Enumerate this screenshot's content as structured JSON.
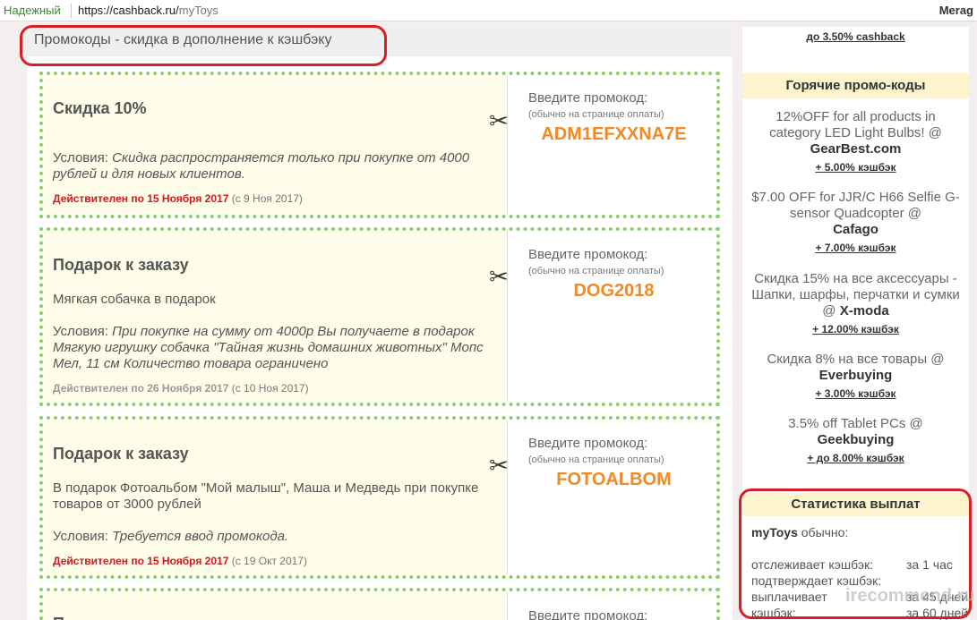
{
  "browser": {
    "secure_label": "Надежный",
    "url_host": "https://cashback.ru/",
    "url_path": "myToys",
    "user": "Merag"
  },
  "main": {
    "title": "Промокоды - скидка в дополнение к кэшбэку",
    "promos": [
      {
        "title": "Скидка 10%",
        "desc": "",
        "cond_label": "Условия:",
        "cond_text": "Скидка распространяется только при покупке от 4000 рублей и для новых клиентов.",
        "valid": "Действителен по 15 Ноября 2017",
        "since": "(с 9 Ноя 2017)",
        "enter_label": "Введите промокод:",
        "enter_hint": "(обычно на странице оплаты)",
        "code": "ADM1EFXXNA7E"
      },
      {
        "title": "Подарок к заказу",
        "desc": "Мягкая собачка в подарок",
        "cond_label": "Условия:",
        "cond_text": "При покупке на сумму от 4000р Вы получаете в подарок Мягкую игрушку собачка \"Тайная жизнь домашних животных\" Мопс Мел, 11 см Количество товара ограничено",
        "valid": "Действителен по 26 Ноября 2017",
        "since": "(с 10 Ноя 2017)",
        "enter_label": "Введите промокод:",
        "enter_hint": "(обычно на странице оплаты)",
        "code": "DOG2018"
      },
      {
        "title": "Подарок к заказу",
        "desc": "В подарок Фотоальбом \"Мой малыш\", Маша и Медведь при покупке товаров от 3000 рублей",
        "cond_label": "Условия:",
        "cond_text": "Требуется ввод промокода.",
        "valid": "Действителен по 15 Ноября 2017",
        "since": "(с 19 Окт 2017)",
        "enter_label": "Введите промокод:",
        "enter_hint": "(обычно на странице оплаты)",
        "code": "FOTOALBOM"
      },
      {
        "title": "П",
        "enter_label": "Введите промокод:"
      }
    ]
  },
  "sidebar": {
    "top_link": "до 3.50% cashback",
    "hot_title": "Горячие промо-коды",
    "hot": [
      {
        "text": "12%OFF for all products in category LED Light Bulbs! @",
        "store": "GearBest.com",
        "cashback": "+ 5.00% кэшбэк"
      },
      {
        "text": "$7.00 OFF for JJR/C H66 Selfie G-sensor Quadcopter @",
        "store": "Cafago",
        "cashback": "+ 7.00% кэшбэк"
      },
      {
        "text": "Скидка 15% на все аксессуары - Шапки, шарфы, перчатки и сумки @",
        "store": "X-moda",
        "cashback": "+ 12.00% кэшбэк"
      },
      {
        "text": "Скидка 8% на все товары @",
        "store": "Everbuying",
        "cashback": "+ 3.00% кэшбэк"
      },
      {
        "text": "3.5% off Tablet PCs @",
        "store": "Geekbuying",
        "cashback": "+ до 8.00% кэшбэк"
      }
    ],
    "stats_title": "Статистика выплат",
    "stats_store": "myToys",
    "stats_usually": "обычно:",
    "stats": [
      {
        "label": "отслеживает кэшбэк:",
        "value": "за 1 час"
      },
      {
        "label": "подтверждает кэшбэк:",
        "value": ""
      },
      {
        "label": "выплачивает",
        "value": "за 45 дней"
      },
      {
        "label": "кэшбэк:",
        "value": "за 60 дней"
      }
    ]
  },
  "watermark": "irecommend.ru",
  "colors": {
    "accent_red": "#d81f26",
    "code_orange": "#f08a24",
    "dotted_green": "#8fce6b",
    "valid_red": "#d11a1a"
  }
}
